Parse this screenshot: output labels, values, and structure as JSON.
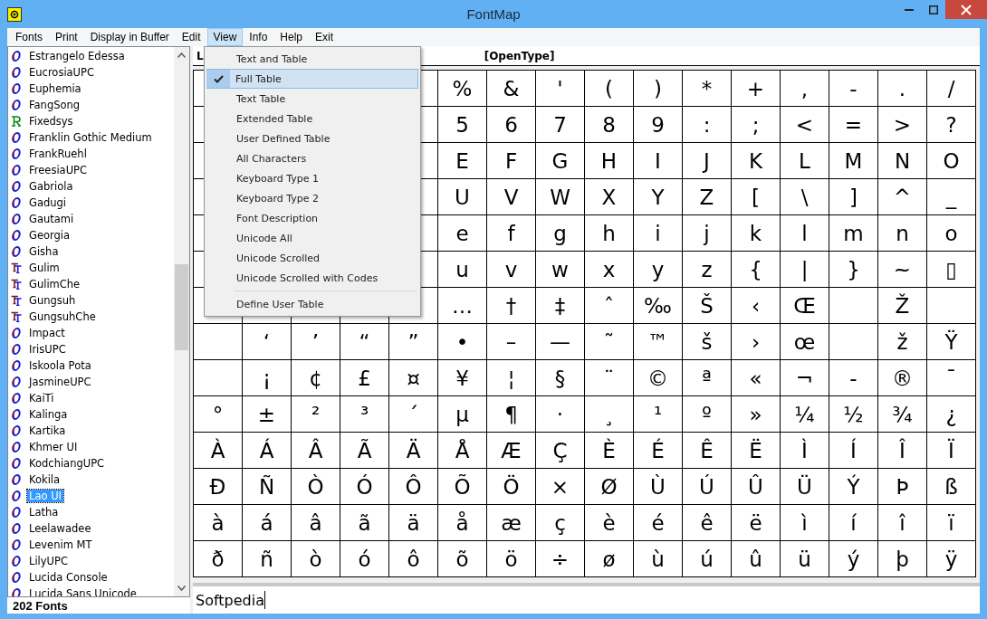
{
  "window": {
    "title": "FontMap"
  },
  "menu_bar": [
    {
      "label": "Fonts",
      "selected": false
    },
    {
      "label": "Print",
      "selected": false
    },
    {
      "label": "Display in Buffer",
      "selected": false
    },
    {
      "label": "Edit",
      "selected": false
    },
    {
      "label": "View",
      "selected": true
    },
    {
      "label": "Info",
      "selected": false
    },
    {
      "label": "Help",
      "selected": false
    },
    {
      "label": "Exit",
      "selected": false
    }
  ],
  "view_menu": {
    "items": [
      {
        "label": "Text and Table",
        "checked": false,
        "selected": false
      },
      {
        "label": "Full Table",
        "checked": true,
        "selected": true
      },
      {
        "label": "Text Table",
        "checked": false,
        "selected": false
      },
      {
        "label": "Extended Table",
        "checked": false,
        "selected": false
      },
      {
        "label": "User Defined Table",
        "checked": false,
        "selected": false
      },
      {
        "label": "All Characters",
        "checked": false,
        "selected": false
      },
      {
        "label": "Keyboard Type 1",
        "checked": false,
        "selected": false
      },
      {
        "label": "Keyboard Type 2",
        "checked": false,
        "selected": false
      },
      {
        "label": "Font Description",
        "checked": false,
        "selected": false
      },
      {
        "label": "Unicode All",
        "checked": false,
        "selected": false
      },
      {
        "label": "Unicode Scrolled",
        "checked": false,
        "selected": false
      },
      {
        "label": "Unicode Scrolled with Codes",
        "checked": false,
        "selected": false
      },
      {
        "label": "Define User Table",
        "checked": false,
        "selected": false,
        "separator_before": true
      }
    ]
  },
  "font_list": {
    "items": [
      {
        "name": "Estrangelo Edessa",
        "kind": "opentype",
        "selected": false
      },
      {
        "name": "EucrosiaUPC",
        "kind": "opentype",
        "selected": false
      },
      {
        "name": "Euphemia",
        "kind": "opentype",
        "selected": false
      },
      {
        "name": "FangSong",
        "kind": "opentype",
        "selected": false
      },
      {
        "name": "Fixedsys",
        "kind": "raster",
        "selected": false
      },
      {
        "name": "Franklin Gothic Medium",
        "kind": "opentype",
        "selected": false
      },
      {
        "name": "FrankRuehl",
        "kind": "opentype",
        "selected": false
      },
      {
        "name": "FreesiaUPC",
        "kind": "opentype",
        "selected": false
      },
      {
        "name": "Gabriola",
        "kind": "opentype",
        "selected": false
      },
      {
        "name": "Gadugi",
        "kind": "opentype",
        "selected": false
      },
      {
        "name": "Gautami",
        "kind": "opentype",
        "selected": false
      },
      {
        "name": "Georgia",
        "kind": "opentype",
        "selected": false
      },
      {
        "name": "Gisha",
        "kind": "opentype",
        "selected": false
      },
      {
        "name": "Gulim",
        "kind": "truetype",
        "selected": false
      },
      {
        "name": "GulimChe",
        "kind": "truetype",
        "selected": false
      },
      {
        "name": "Gungsuh",
        "kind": "truetype",
        "selected": false
      },
      {
        "name": "GungsuhChe",
        "kind": "truetype",
        "selected": false
      },
      {
        "name": "Impact",
        "kind": "opentype",
        "selected": false
      },
      {
        "name": "IrisUPC",
        "kind": "opentype",
        "selected": false
      },
      {
        "name": "Iskoola Pota",
        "kind": "opentype",
        "selected": false
      },
      {
        "name": "JasmineUPC",
        "kind": "opentype",
        "selected": false
      },
      {
        "name": "KaiTi",
        "kind": "opentype",
        "selected": false
      },
      {
        "name": "Kalinga",
        "kind": "opentype",
        "selected": false
      },
      {
        "name": "Kartika",
        "kind": "opentype",
        "selected": false
      },
      {
        "name": "Khmer UI",
        "kind": "opentype",
        "selected": false
      },
      {
        "name": "KodchiangUPC",
        "kind": "opentype",
        "selected": false
      },
      {
        "name": "Kokila",
        "kind": "opentype",
        "selected": false
      },
      {
        "name": "Lao UI",
        "kind": "opentype",
        "selected": true
      },
      {
        "name": "Latha",
        "kind": "opentype",
        "selected": false
      },
      {
        "name": "Leelawadee",
        "kind": "opentype",
        "selected": false
      },
      {
        "name": "Levenim MT",
        "kind": "opentype",
        "selected": false
      },
      {
        "name": "LilyUPC",
        "kind": "opentype",
        "selected": false
      },
      {
        "name": "Lucida Console",
        "kind": "opentype",
        "selected": false
      },
      {
        "name": "Lucida Sans Unicode",
        "kind": "opentype",
        "selected": false
      }
    ],
    "count": "202 Fonts"
  },
  "table_header": {
    "font_name": "L",
    "font_type": "[OpenType]"
  },
  "char_table": {
    "rows": [
      [
        null,
        null,
        null,
        null,
        null,
        "%",
        "&",
        "'",
        "(",
        ")",
        "*",
        "+",
        ",",
        "-",
        ".",
        "/"
      ],
      [
        null,
        null,
        null,
        null,
        null,
        "5",
        "6",
        "7",
        "8",
        "9",
        ":",
        ";",
        "<",
        "=",
        ">",
        "?"
      ],
      [
        null,
        null,
        null,
        null,
        null,
        "E",
        "F",
        "G",
        "H",
        "I",
        "J",
        "K",
        "L",
        "M",
        "N",
        "O"
      ],
      [
        null,
        null,
        null,
        null,
        null,
        "U",
        "V",
        "W",
        "X",
        "Y",
        "Z",
        "[",
        "\\",
        "]",
        "^",
        "_"
      ],
      [
        null,
        null,
        null,
        null,
        null,
        "e",
        "f",
        "g",
        "h",
        "i",
        "j",
        "k",
        "l",
        "m",
        "n",
        "o"
      ],
      [
        null,
        null,
        null,
        null,
        null,
        "u",
        "v",
        "w",
        "x",
        "y",
        "z",
        "{",
        "|",
        "}",
        "~",
        "▯"
      ],
      [
        null,
        null,
        null,
        null,
        null,
        "…",
        "†",
        "‡",
        "ˆ",
        "‰",
        "Š",
        "‹",
        "Œ",
        null,
        "Ž",
        null
      ],
      [
        null,
        "‘",
        "’",
        "“",
        "”",
        "•",
        "–",
        "—",
        "˜",
        "™",
        "š",
        "›",
        "œ",
        null,
        "ž",
        "Ÿ"
      ],
      [
        null,
        "¡",
        "¢",
        "£",
        "¤",
        "¥",
        "¦",
        "§",
        "¨",
        "©",
        "ª",
        "«",
        "¬",
        "-",
        "®",
        "¯"
      ],
      [
        "°",
        "±",
        "²",
        "³",
        "´",
        "µ",
        "¶",
        "·",
        "¸",
        "¹",
        "º",
        "»",
        "¼",
        "½",
        "¾",
        "¿"
      ],
      [
        "À",
        "Á",
        "Â",
        "Ã",
        "Ä",
        "Å",
        "Æ",
        "Ç",
        "È",
        "É",
        "Ê",
        "Ë",
        "Ì",
        "Í",
        "Î",
        "Ï"
      ],
      [
        "Ð",
        "Ñ",
        "Ò",
        "Ó",
        "Ô",
        "Õ",
        "Ö",
        "×",
        "Ø",
        "Ù",
        "Ú",
        "Û",
        "Ü",
        "Ý",
        "Þ",
        "ß"
      ],
      [
        "à",
        "á",
        "â",
        "ã",
        "ä",
        "å",
        "æ",
        "ç",
        "è",
        "é",
        "ê",
        "ë",
        "ì",
        "í",
        "î",
        "ï"
      ],
      [
        "ð",
        "ñ",
        "ò",
        "ó",
        "ô",
        "õ",
        "ö",
        "÷",
        "ø",
        "ù",
        "ú",
        "û",
        "ü",
        "ý",
        "þ",
        "ÿ"
      ]
    ]
  },
  "sample_text": {
    "value": "Softpedia"
  }
}
